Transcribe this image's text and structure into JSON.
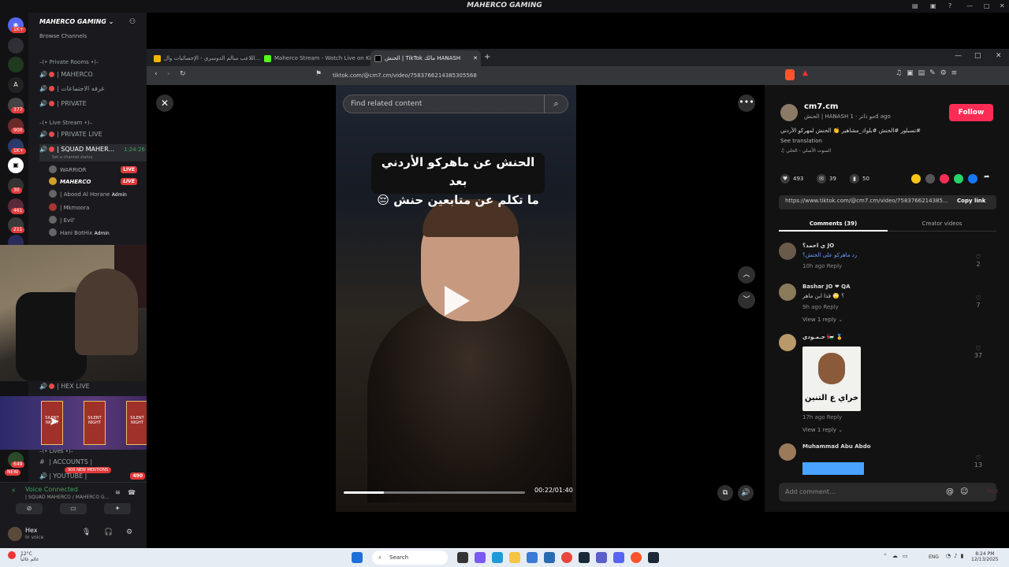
{
  "discord": {
    "window_title": "MAHERCO GAMING",
    "server_name": "MAHERCO GAMING",
    "browse_channels": "Browse Channels",
    "categories": {
      "private": "–(• Private Rooms •)–",
      "livestream": "–(• Live Stream •)–",
      "lives": "–(• Lives •)–"
    },
    "channels": {
      "maherco": "| MAHERCO",
      "meeting": "| غرفه الاجتماعات",
      "private": "| PRIVATE",
      "private_live": "| PRIVATE LIVE",
      "squad": "| SQUAD MAHER...",
      "squad_time": "1:24:26",
      "squad_status": "Set a channel status",
      "hex_live": "| HEX LIVE",
      "accounts": "| ACCOUNTS |",
      "youtube": "| YOUTUBE |"
    },
    "members": [
      {
        "name": "WARRIOR",
        "badge": "LIVE"
      },
      {
        "name": "MAHERCO",
        "badge": "LIVE"
      },
      {
        "name": "| Abood Al Horane",
        "badge": "Admin"
      },
      {
        "name": "| Mkmoora",
        "badge": ""
      },
      {
        "name": "| Evil'",
        "badge": ""
      },
      {
        "name": "Hani BotHix",
        "badge": "Admin"
      }
    ],
    "server_badges": [
      "1K+",
      "377",
      "900",
      "1K+",
      "30",
      "461",
      "211",
      "649"
    ],
    "new_badge": "NEW",
    "mentions_badge": "900 NEW MENTIONS",
    "youtube_count": "490",
    "stream_cards": [
      "SILENT NIGHT",
      "SILENT NIGHT",
      "SILENT NIGHT"
    ],
    "voice": {
      "title": "Voice Connected",
      "channel": "| SQUAD MAHERCO / MAHERCO G..."
    },
    "user": {
      "name": "Hex",
      "status": "In voice"
    }
  },
  "browser": {
    "tabs": [
      {
        "title": "اللاعب سالم الدوسري - الإحصائيات وال..."
      },
      {
        "title": "Maherco Stream - Watch Live on Kick"
      },
      {
        "title": "الحنش | TikTok مالك HANASH"
      }
    ],
    "url": "tiktok.com/@cm7.cm/video/7583766214385305568"
  },
  "tiktok": {
    "search_placeholder": "Find related content",
    "caption_line1": "الحنش عن ماهركو الأردني بعد",
    "caption_line2": "ما تكلم عن متابعين حنش 😔",
    "time": "00:22/01:40",
    "progress": 0.22,
    "author": {
      "handle": "cm7.cm",
      "subtitle": "الحنش | HANASH مو ذاتر · 1d ago",
      "follow": "Follow"
    },
    "description": "#تسبلور #الحنش #بلوك_مشاهير 👏 الحنش لمهركو الأردني",
    "see_translation": "See translation",
    "sound": "♫ الصوت الأصلي - الحلي",
    "stats": {
      "likes": "493",
      "comments": "39",
      "saves": "50"
    },
    "share_colors": [
      "#f5c518",
      "#555555",
      "#fe2c55",
      "#25d366",
      "#1877f2"
    ],
    "link": "https://www.tiktok.com/@cm7.cm/video/7583766214385...",
    "copy_link": "Copy link",
    "tab_comments": "Comments (39)",
    "tab_creator": "Creator videos",
    "comments": [
      {
        "name": "ي احمد؟ JO",
        "text": "رد ماهركو على الحنش؟",
        "meta": "10h ago     Reply",
        "likes": "2",
        "views": ""
      },
      {
        "name": "Bashar JO ❤ QA",
        "text": "؟ 🙄 قذا ابن ماهر",
        "meta": "9h ago     Reply",
        "likes": "7",
        "views": "View 1 reply ⌄"
      },
      {
        "name": "حـمـودي 🇯🇴 🏅",
        "text": "",
        "meta": "17h ago     Reply",
        "likes": "37",
        "views": "View 1 reply ⌄"
      },
      {
        "name": "Muhammad Abu Abdo",
        "text": "",
        "meta": "",
        "likes": "13",
        "views": ""
      }
    ],
    "sticker_text": "خراي ع التنين",
    "add_comment": "Add comment...",
    "post": "Post"
  },
  "taskbar": {
    "weather": "12°C",
    "weather_sub": "غائم غالباً",
    "search": "Search",
    "lang": "ENG",
    "time": "8:24 PM",
    "date": "12/13/2025"
  }
}
